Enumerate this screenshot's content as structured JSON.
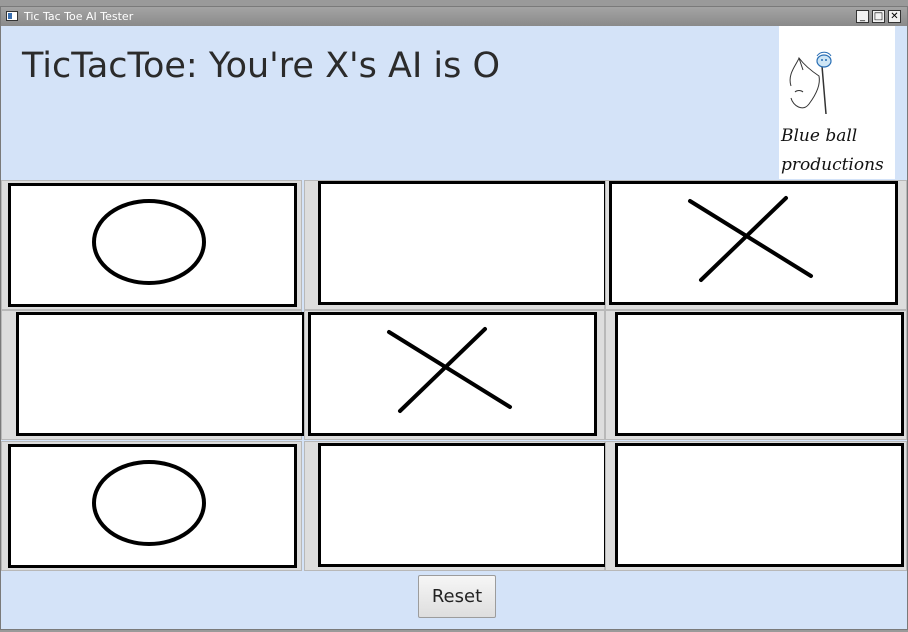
{
  "window": {
    "title": "Tic Tac Toe AI Tester",
    "controls": {
      "minimize": "_",
      "maximize": "□",
      "close": "✕"
    }
  },
  "header": {
    "heading": "TicTacToe: You're X's AI is O"
  },
  "logo": {
    "line1": "Blue ball",
    "line2": "productions"
  },
  "board": {
    "rows": [
      [
        "O",
        "",
        "X"
      ],
      [
        "",
        "X",
        ""
      ],
      [
        "O",
        "",
        ""
      ]
    ]
  },
  "controls": {
    "reset_label": "Reset"
  }
}
